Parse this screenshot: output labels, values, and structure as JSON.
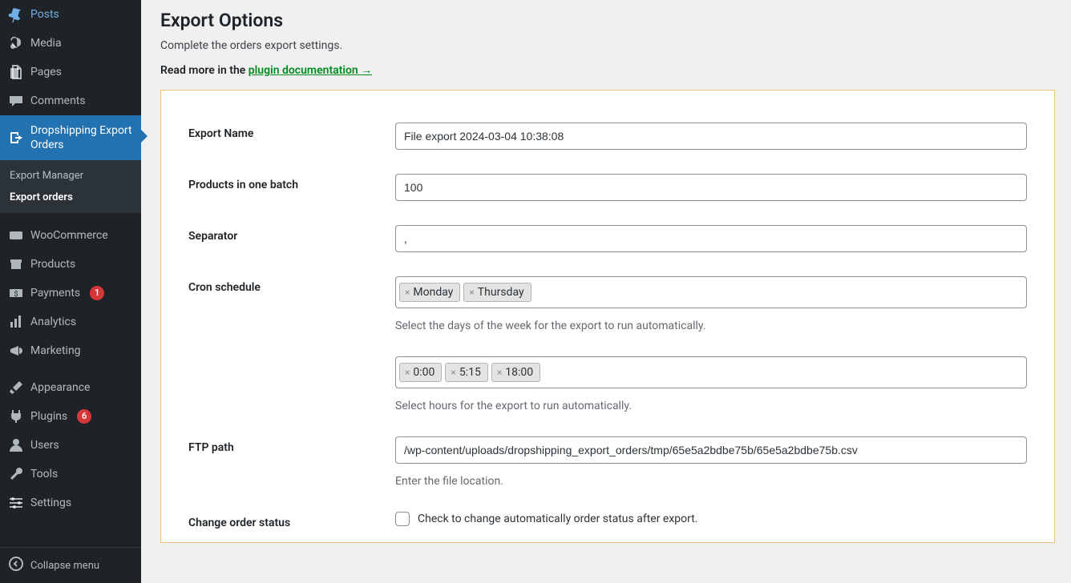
{
  "sidebar": {
    "items": [
      {
        "id": "posts",
        "label": "Posts"
      },
      {
        "id": "media",
        "label": "Media"
      },
      {
        "id": "pages",
        "label": "Pages"
      },
      {
        "id": "comments",
        "label": "Comments"
      },
      {
        "id": "dropship",
        "label": "Dropshipping Export Orders"
      },
      {
        "id": "woo",
        "label": "WooCommerce"
      },
      {
        "id": "products",
        "label": "Products"
      },
      {
        "id": "payments",
        "label": "Payments",
        "badge": "1"
      },
      {
        "id": "analytics",
        "label": "Analytics"
      },
      {
        "id": "marketing",
        "label": "Marketing"
      },
      {
        "id": "appearance",
        "label": "Appearance"
      },
      {
        "id": "plugins",
        "label": "Plugins",
        "badge": "6"
      },
      {
        "id": "users",
        "label": "Users"
      },
      {
        "id": "tools",
        "label": "Tools"
      },
      {
        "id": "settings",
        "label": "Settings"
      }
    ],
    "submenu": {
      "export_manager": "Export Manager",
      "export_orders": "Export orders"
    },
    "collapse": "Collapse menu"
  },
  "page": {
    "title": "Export Options",
    "subtitle": "Complete the orders export settings.",
    "readmore_pre": "Read more in the ",
    "readmore_link": "plugin documentation →"
  },
  "form": {
    "export_name": {
      "label": "Export Name",
      "value": "File export 2024-03-04 10:38:08"
    },
    "batch": {
      "label": "Products in one batch",
      "value": "100"
    },
    "separator": {
      "label": "Separator",
      "value": ","
    },
    "cron_days": {
      "label": "Cron schedule",
      "tags": [
        "Monday",
        "Thursday"
      ],
      "help": "Select the days of the week for the export to run automatically."
    },
    "cron_hours": {
      "tags": [
        "0:00",
        "5:15",
        "18:00"
      ],
      "help": "Select hours for the export to run automatically."
    },
    "ftp": {
      "label": "FTP path",
      "value": "/wp-content/uploads/dropshipping_export_orders/tmp/65e5a2bdbe75b/65e5a2bdbe75b.csv",
      "help": "Enter the file location."
    },
    "change_status": {
      "label": "Change order status",
      "checkbox_label": "Check to change automatically order status after export."
    }
  }
}
